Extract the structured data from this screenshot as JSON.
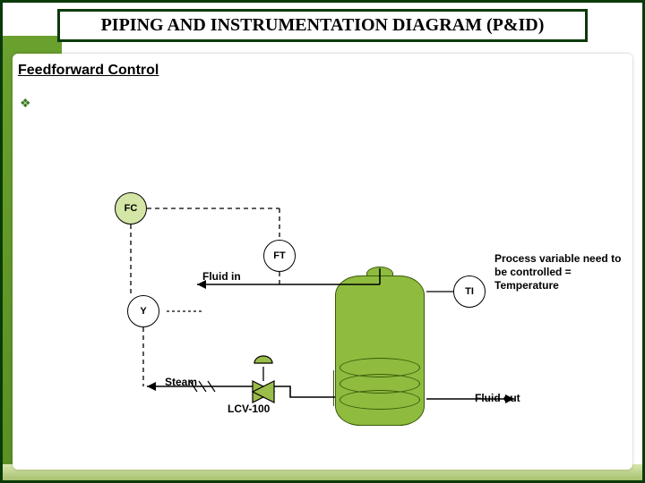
{
  "title": "PIPING AND INSTRUMENTATION DIAGRAM (P&ID)",
  "section": "Feedforward Control",
  "bullet_symbol": "❖",
  "instruments": {
    "fc_tag": "FC",
    "ft_tag": "FT",
    "y_tag": "Y",
    "ti_tag": "TI"
  },
  "labels": {
    "fluid_in": "Fluid in",
    "steam": "Steam",
    "lcv": "LCV-100",
    "fluid_out": "Fluid out"
  },
  "note": "Process variable need to be controlled = Temperature",
  "colors": {
    "frame_dark": "#0a3a0a",
    "accent_green": "#8fbc3f",
    "light_green": "#d3e6a6"
  },
  "diagram_semantics": {
    "control_type": "feedforward",
    "manipulated_variable": "steam flow via LCV-100",
    "controlled_variable": "temperature (TI)",
    "disturbance_measured": "fluid inlet flow (FT)",
    "signal_lines": "dashed = instrument/signal, solid = process piping",
    "instruments": [
      {
        "tag": "FC",
        "role": "flow controller (feedforward block)"
      },
      {
        "tag": "FT",
        "role": "flow transmitter on fluid-in line"
      },
      {
        "tag": "Y",
        "role": "computing relay / I-P converter to valve"
      },
      {
        "tag": "TI",
        "role": "temperature indicator on tank"
      }
    ]
  }
}
